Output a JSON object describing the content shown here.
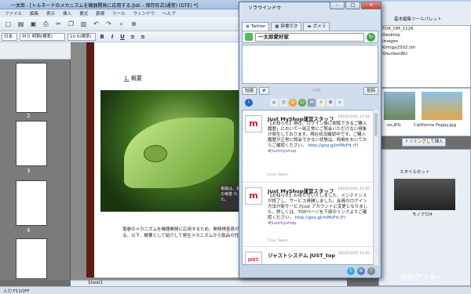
{
  "app": {
    "title": "一太郎 - [トルネードのメカニズムを機器開発に応用する.jtdc - 保存形式(通常) (DTE) *]"
  },
  "menu": [
    "ファイル",
    "編集",
    "表示",
    "挿入",
    "書式",
    "罫線",
    "ツール",
    "ウィンドウ",
    "ヘルプ"
  ],
  "format": {
    "lang": "日本",
    "font": "ＭＳ 明朝(標準)",
    "size": "10.5(標準)"
  },
  "thumbs": {
    "pages": [
      "2",
      "3",
      "4"
    ]
  },
  "document": {
    "heading_num": "1.",
    "heading": "概要",
    "caption": "電磁は、初の竜巻\nれた。",
    "body": "竜巻のメカニズムを機器開発に応用するため、開発検査員が定期的にイベントに報告する等が必要である。以下、概要として紹介して発生メカニズムから製品の性能等に関して発展を推進し、検討を行った。"
  },
  "sheet_tab": "Sheet1",
  "status": {
    "left": "入力 F11OFF"
  },
  "sora": {
    "title": "ソラウインドウ",
    "tabs": [
      "Twitter",
      "辞書引き",
      "ボメラ"
    ],
    "account": "一太郎愛好家",
    "btn_shorten": "短縮",
    "btn_hash": "#",
    "counter": "140",
    "btn_post": "投稿",
    "tweets": [
      {
        "avatar": "m",
        "name": "Just MyShop運営スタッフ",
        "date": "2010/12/01 17:24",
        "text": "【お知らせ】現在、ログイン後に閲覧できるご購入履歴」において一部正常にご照会いただけない現象が発生しております。現在状況確認中です。ご購入履歴が正常に照会できない状態は、時間をおいてからご確認ください。",
        "link": "http://goo.gl/mMsFd",
        "tag": "(F) #justmyshop",
        "from": "From Tween"
      },
      {
        "avatar": "m",
        "name": "Just MyShop運営スタッフ",
        "date": "2010/12/01 17:05",
        "text": "【お知らせ】お待たせいたしました、メンテナンスが終了し、サービス再開しました。会員のログイン方法が新サービスJust アカウントに変更となりました。詳しくは、TOPページを下部のリンクよりご確認ください。",
        "link": "http://goo.gl/mMsFd",
        "tag": "(F) #justmyshop",
        "from": "From Tween"
      },
      {
        "avatar": "JUST.",
        "name": "ジャストシステム JUST_top",
        "date": "2010/12/01 11:45"
      }
    ]
  },
  "right": {
    "header": "基本編集ツールパレット",
    "files": [
      "FOK_DM_1126",
      "Desktop",
      "images",
      "kimiga2502.lzh",
      "ShurikenBU"
    ],
    "images": [
      {
        "label": "oo.JPG"
      },
      {
        "label": "California Poppy.jpg"
      }
    ],
    "button": "トリミングして挿入",
    "section": "スタイルセット",
    "swatch": "モノクロ4"
  },
  "watermark": "週刊アスキー"
}
